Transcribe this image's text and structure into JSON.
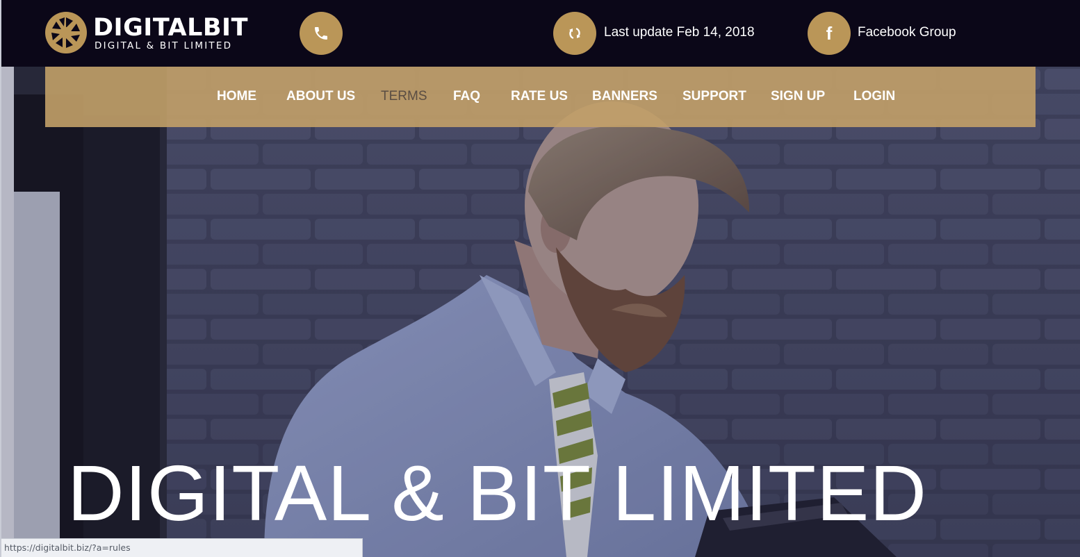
{
  "header": {
    "logo_name": "DIGITALBIT",
    "logo_subtitle": "DIGITAL & BIT LIMITED",
    "update_text": "Last update Feb 14, 2018",
    "facebook_text": "Facebook Group",
    "facebook_glyph": "f",
    "icons": [
      "phone-icon",
      "refresh-icon",
      "facebook-icon"
    ]
  },
  "nav": {
    "items": [
      {
        "label": "HOME"
      },
      {
        "label": "ABOUT US"
      },
      {
        "label": "TERMS"
      },
      {
        "label": "FAQ"
      },
      {
        "label": "RATE US"
      },
      {
        "label": "BANNERS"
      },
      {
        "label": "SUPPORT"
      },
      {
        "label": "SIGN UP"
      },
      {
        "label": "LOGIN"
      }
    ],
    "active": "TERMS"
  },
  "hero": {
    "title": "DIGITAL & BIT LIMITED"
  },
  "status_bar": {
    "url": "https://digitalbit.biz/?a=rules"
  },
  "colors": {
    "topbar_bg": "#0b0718",
    "accent_gold": "#ba9658",
    "nav_bg": "#c2a068",
    "nav_active_text": "#5a4d43",
    "white": "#ffffff"
  }
}
